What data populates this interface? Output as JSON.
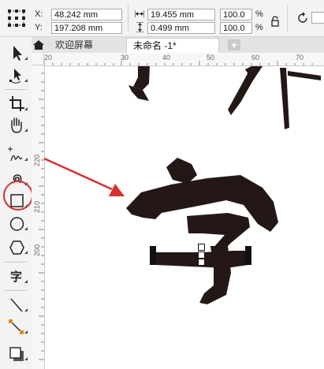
{
  "propbar": {
    "x_label": "X:",
    "y_label": "Y:",
    "x_value": "48.242 mm",
    "y_value": "197.208 mm",
    "width_value": "19.455 mm",
    "height_value": "0.499 mm",
    "scale_x": "100.0",
    "scale_y": "100.0",
    "percent": "%"
  },
  "tabs": {
    "welcome": "欢迎屏幕",
    "document": "未命名 -1*",
    "add": "+"
  },
  "ruler": {
    "h_ticks": [
      "20",
      "30",
      "40",
      "50",
      "60",
      "70"
    ],
    "v_ticks": [
      "220",
      "210",
      "200"
    ]
  },
  "toolbox": {
    "text_tool_glyph": "字",
    "highlighted_tool": "freehand-tool-icon"
  },
  "colors": {
    "annotation": "#d93030",
    "shape_fill": "#231815"
  }
}
